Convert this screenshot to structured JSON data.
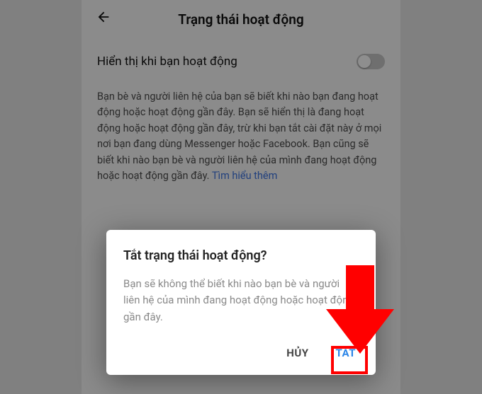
{
  "header": {
    "title": "Trạng thái hoạt động"
  },
  "settings": {
    "toggle_label": "Hiển thị khi bạn hoạt động",
    "toggle_on": false,
    "description": "Bạn bè và người liên hệ của bạn sẽ biết khi nào bạn đang hoạt động hoặc hoạt động gần đây. Bạn sẽ hiển thị là đang hoạt động hoặc hoạt động gần đây, trừ khi bạn tắt cài đặt này ở mọi nơi bạn đang dùng Messenger hoặc Facebook. Bạn cũng sẽ biết khi nào bạn bè và người liên hệ của mình đang hoạt động hoặc hoạt động gần đây. ",
    "learn_more": "Tìm hiểu thêm"
  },
  "dialog": {
    "title": "Tắt trạng thái hoạt động?",
    "body": "Bạn sẽ không thể biết khi nào bạn bè và người liên hệ của mình đang hoạt động hoặc hoạt động gần đây.",
    "cancel_label": "HỦY",
    "confirm_label": "TẮT"
  },
  "colors": {
    "accent": "#2b86e8",
    "highlight": "#ff0000"
  }
}
